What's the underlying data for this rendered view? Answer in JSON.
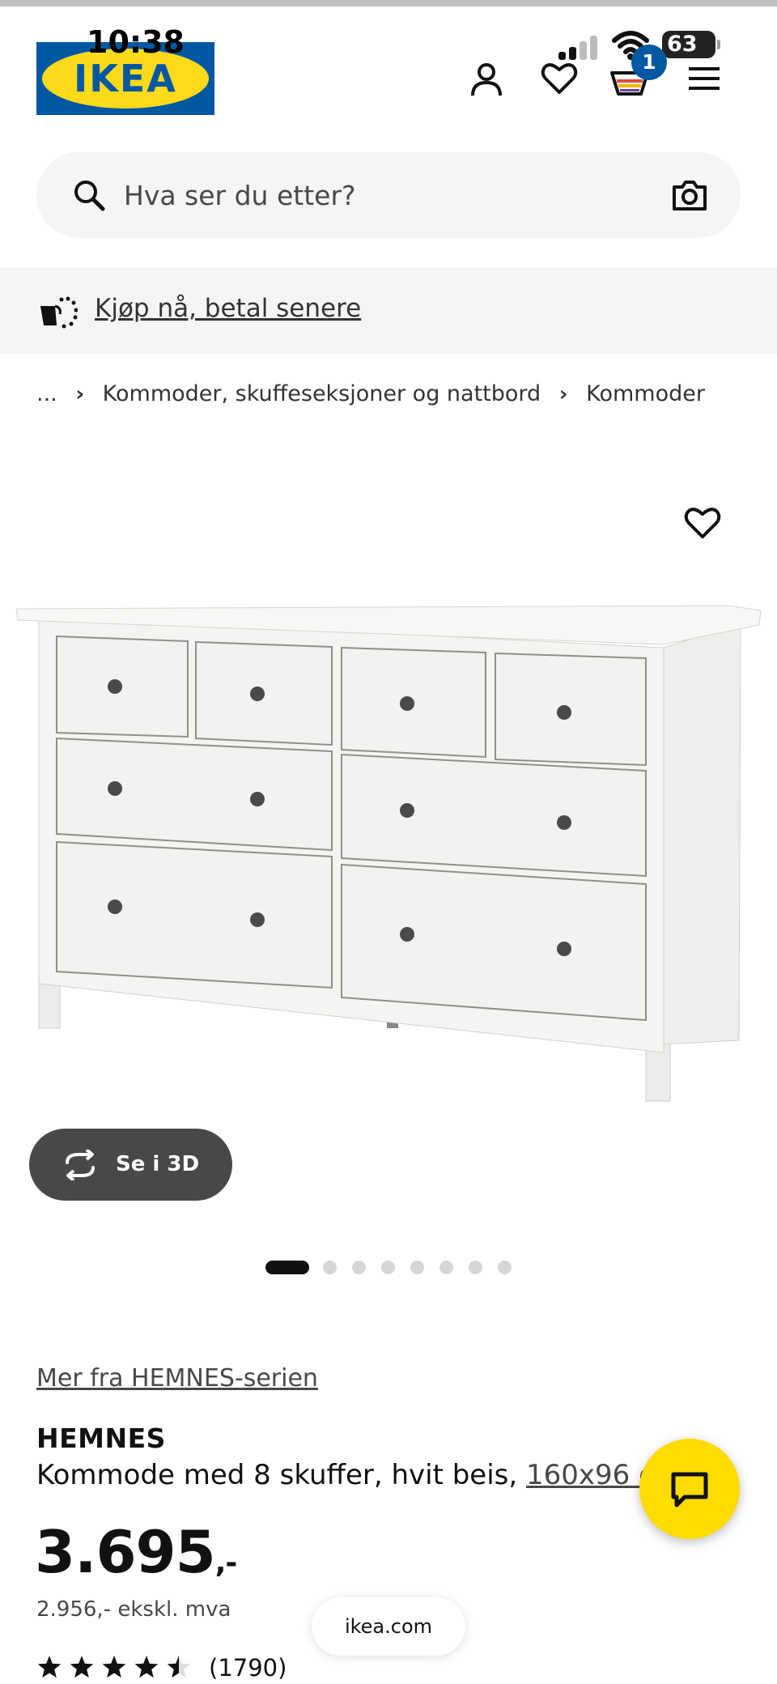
{
  "status_bar": {
    "time": "10:38",
    "battery": "63"
  },
  "header": {
    "logo_text": "IKEA",
    "cart_count": "1"
  },
  "search": {
    "placeholder": "Hva ser du etter?"
  },
  "promo": {
    "label": "Kjøp nå, betal senere"
  },
  "breadcrumb": {
    "ellipsis": "...",
    "items": [
      "Kommoder, skuffeseksjoner og nattbord",
      "Kommoder"
    ]
  },
  "gallery": {
    "view_3d_label": "Se i 3D",
    "image_count": 8,
    "active_index": 0
  },
  "product": {
    "series_link": "Mer fra HEMNES-serien",
    "name": "HEMNES",
    "description": "Kommode med 8 skuffer, hvit beis, ",
    "size_link": "160x96 cm",
    "price": "3.695",
    "price_suffix": ",-",
    "price_ex_vat": "2.956,- ekskl. mva",
    "rating": 4.5,
    "rating_max": 5,
    "review_count": "(1790)"
  },
  "browser": {
    "url": "ikea.com"
  },
  "colors": {
    "ikea_blue": "#0058a3",
    "ikea_yellow": "#ffda1a",
    "chat_yellow": "#ffdb00"
  }
}
